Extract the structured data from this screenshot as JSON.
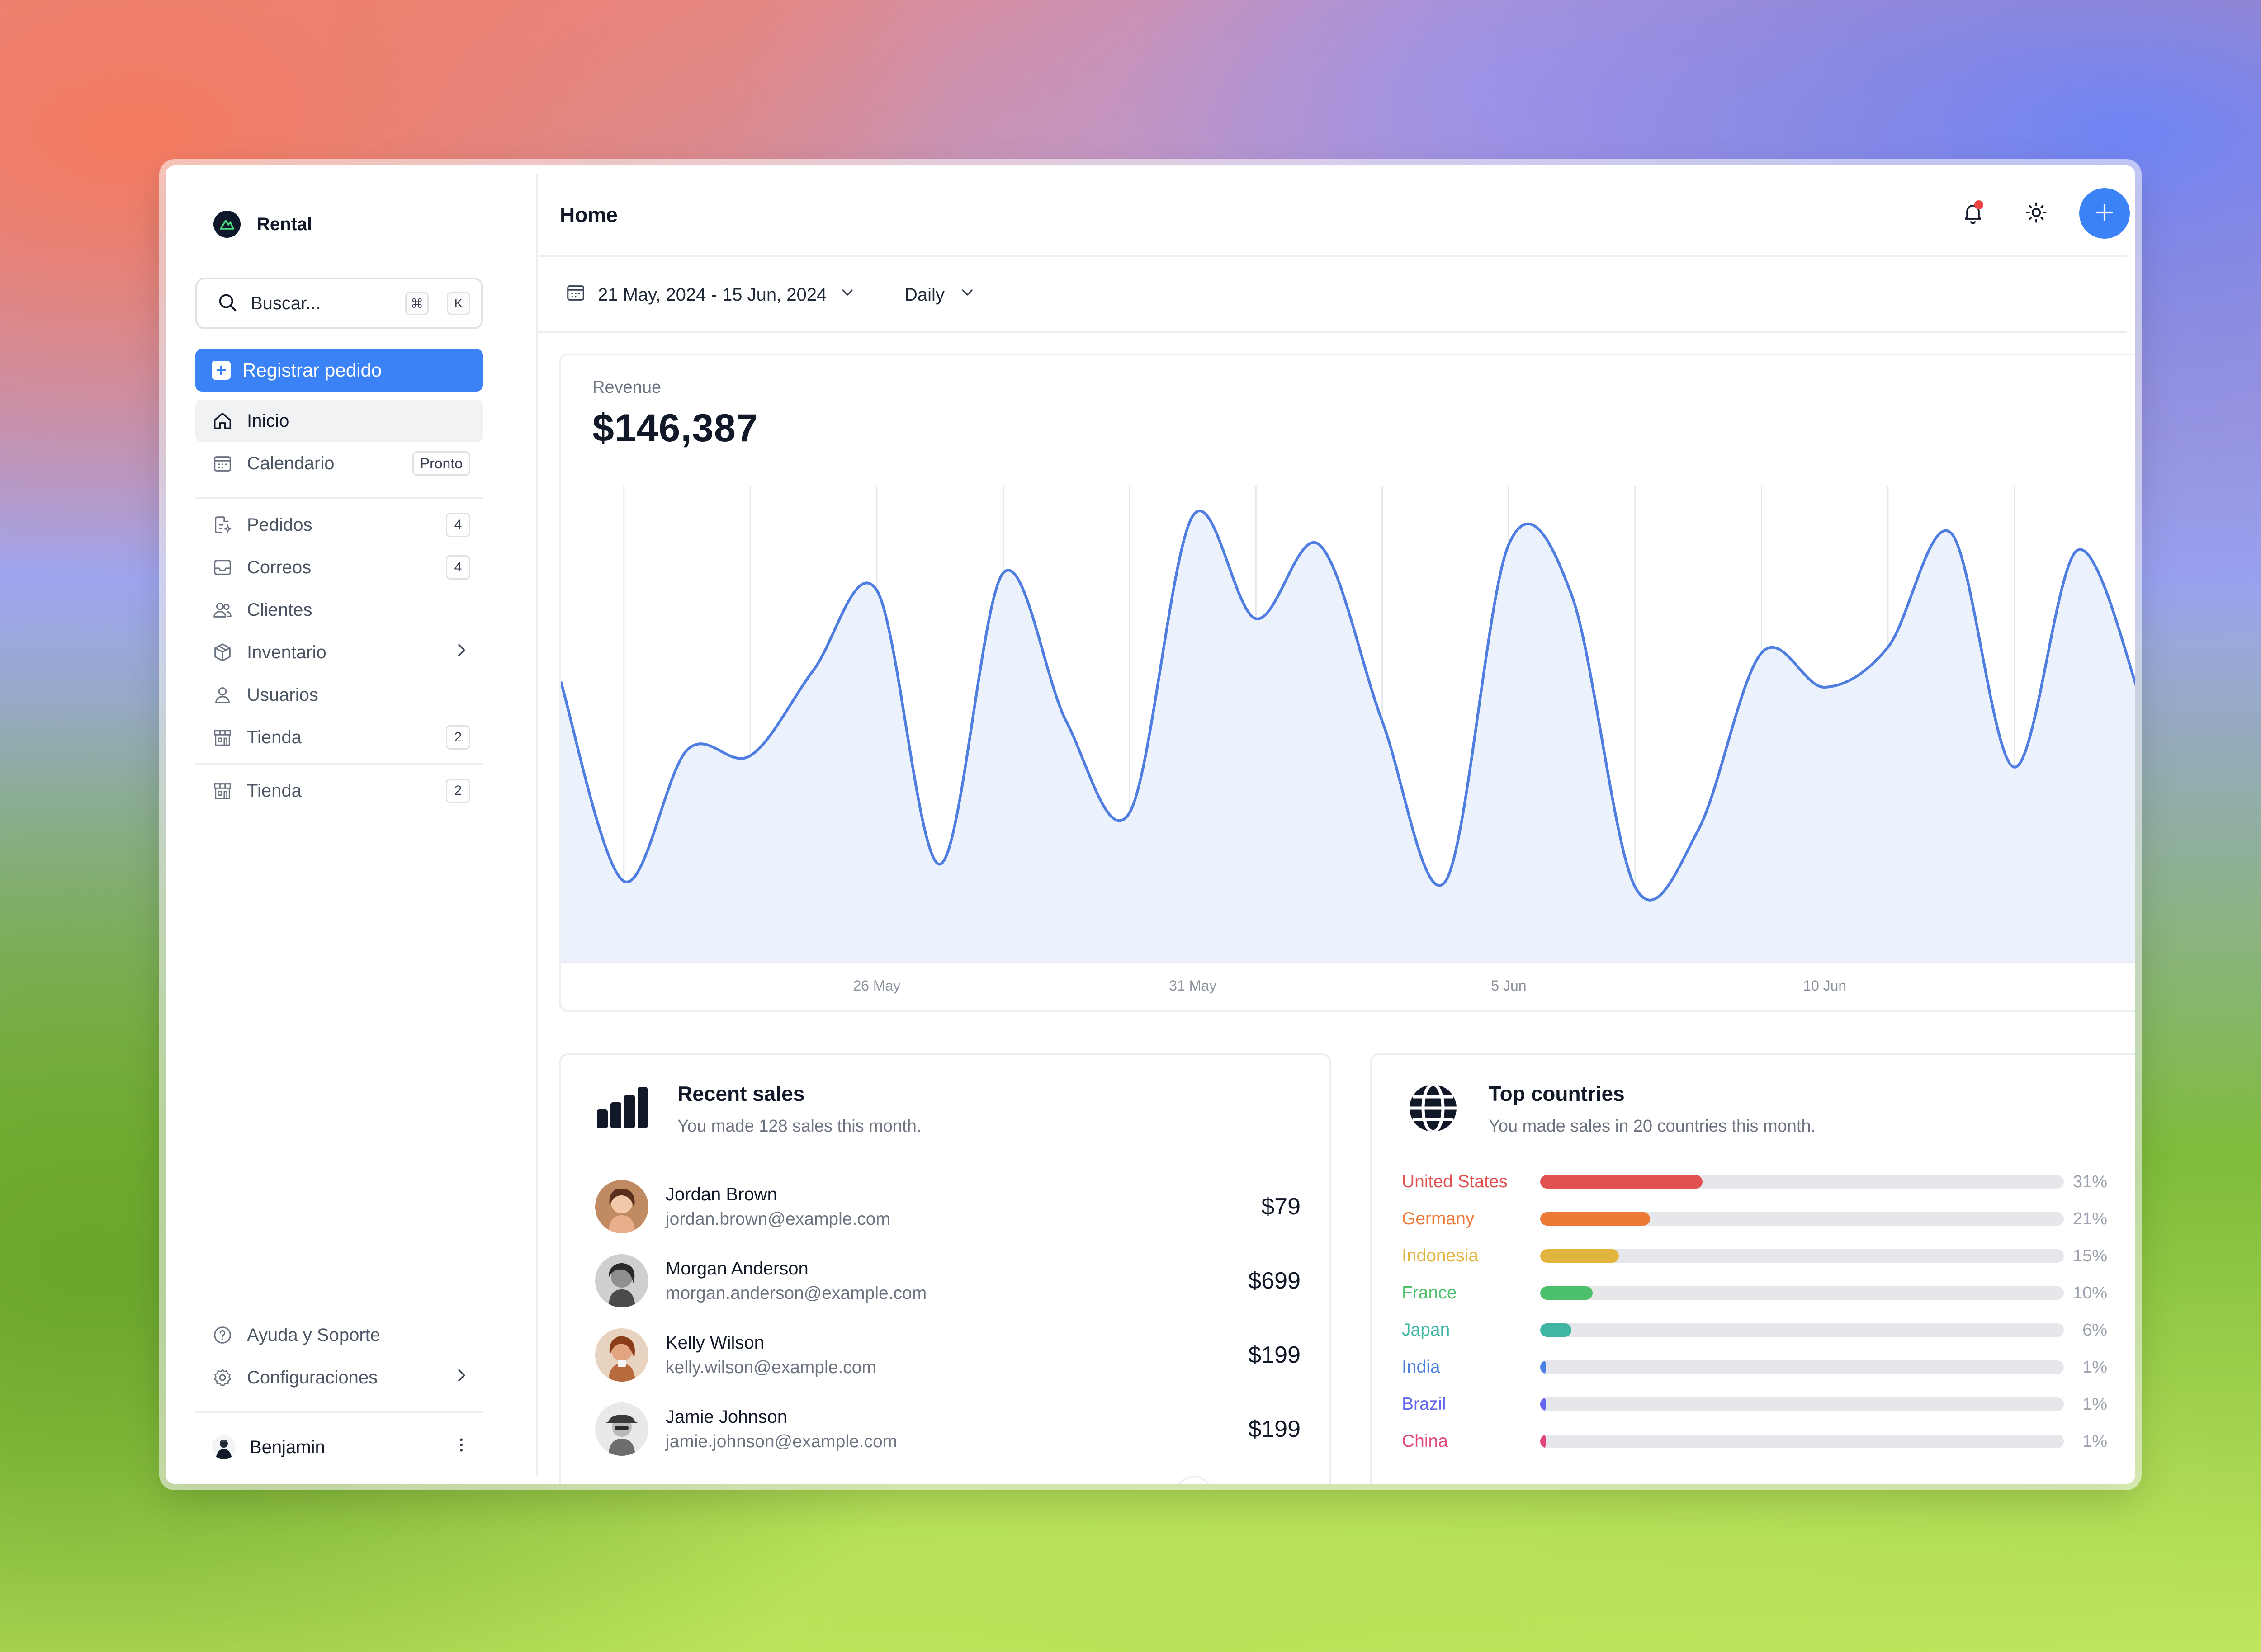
{
  "app": {
    "name": "Rental"
  },
  "search": {
    "placeholder": "Buscar...",
    "kbd_1": "⌘",
    "kbd_2": "K"
  },
  "cta": {
    "label": "Registrar pedido"
  },
  "nav": {
    "items": [
      {
        "label": "Inicio",
        "icon": "home-icon",
        "active": true
      },
      {
        "label": "Calendario",
        "icon": "calendar-icon",
        "badge": "Pronto"
      },
      {
        "label": "Pedidos",
        "icon": "orders-icon",
        "badge": "4"
      },
      {
        "label": "Correos",
        "icon": "inbox-icon",
        "badge": "4"
      },
      {
        "label": "Clientes",
        "icon": "users-icon"
      },
      {
        "label": "Inventario",
        "icon": "box-icon"
      },
      {
        "label": "Usuarios",
        "icon": "user-icon"
      },
      {
        "label": "Tienda",
        "icon": "store-icon",
        "badge": "2"
      },
      {
        "label": "Tienda",
        "icon": "store-icon",
        "badge": "2"
      }
    ],
    "footer": [
      {
        "label": "Ayuda y Soporte",
        "icon": "help-icon"
      },
      {
        "label": "Configuraciones",
        "icon": "settings-icon"
      }
    ]
  },
  "user": {
    "name": "Benjamin"
  },
  "header": {
    "title": "Home"
  },
  "filters": {
    "date_range": "21 May, 2024 - 15 Jun, 2024",
    "period": "Daily"
  },
  "revenue": {
    "label": "Revenue",
    "value": "$146,387"
  },
  "chart_data": {
    "type": "area",
    "x": [
      "21 May",
      "22 May",
      "23 May",
      "24 May",
      "25 May",
      "26 May",
      "27 May",
      "28 May",
      "29 May",
      "30 May",
      "31 May",
      "1 Jun",
      "2 Jun",
      "3 Jun",
      "4 Jun",
      "5 Jun",
      "6 Jun",
      "7 Jun",
      "8 Jun",
      "9 Jun",
      "10 Jun",
      "11 Jun",
      "12 Jun",
      "13 Jun",
      "14 Jun",
      "15 Jun"
    ],
    "x_tick_labels": [
      "26 May",
      "31 May",
      "5 Jun",
      "10 Jun"
    ],
    "series": [
      {
        "values": [
          4900,
          1400,
          3700,
          3600,
          5100,
          6500,
          1700,
          6800,
          4200,
          2600,
          7800,
          6000,
          7300,
          4200,
          1400,
          7300,
          6400,
          1300,
          2300,
          5400,
          4800,
          5500,
          7500,
          3400,
          7200,
          4600
        ]
      }
    ],
    "color": "#4f7de0",
    "fill": "#ecf2fc",
    "grid": "vertical"
  },
  "recent_sales": {
    "title": "Recent sales",
    "subtitle": "You made 128 sales this month.",
    "rows": [
      {
        "name": "Jordan Brown",
        "email": "jordan.brown@example.com",
        "amount": "$79"
      },
      {
        "name": "Morgan Anderson",
        "email": "morgan.anderson@example.com",
        "amount": "$699"
      },
      {
        "name": "Kelly Wilson",
        "email": "kelly.wilson@example.com",
        "amount": "$199"
      },
      {
        "name": "Jamie Johnson",
        "email": "jamie.johnson@example.com",
        "amount": "$199"
      }
    ]
  },
  "top_countries": {
    "title": "Top countries",
    "subtitle": "You made sales in 20 countries this month.",
    "rows": [
      {
        "name": "United States",
        "pct": "31%",
        "value": 31,
        "color": "#e0524f"
      },
      {
        "name": "Germany",
        "pct": "21%",
        "value": 21,
        "color": "#ec7a36"
      },
      {
        "name": "Indonesia",
        "pct": "15%",
        "value": 15,
        "color": "#e2b540"
      },
      {
        "name": "France",
        "pct": "10%",
        "value": 10,
        "color": "#4cc06b"
      },
      {
        "name": "Japan",
        "pct": "6%",
        "value": 6,
        "color": "#3fb5a3"
      },
      {
        "name": "India",
        "pct": "1%",
        "value": 1,
        "color": "#4a7fe0"
      },
      {
        "name": "Brazil",
        "pct": "1%",
        "value": 1,
        "color": "#6366f1"
      },
      {
        "name": "China",
        "pct": "1%",
        "value": 1,
        "color": "#e0457d"
      }
    ]
  }
}
